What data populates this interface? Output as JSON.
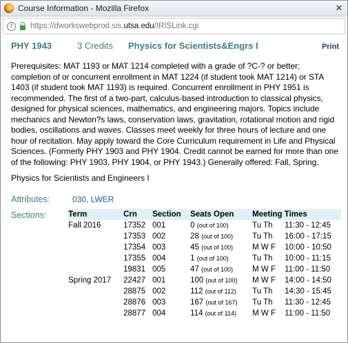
{
  "window": {
    "title": "Course Information - Mozilla Firefox",
    "close_glyph": "✕"
  },
  "urlbar": {
    "url_prefix": "https://dworkswebprod.sis.",
    "url_domain": "utsa.edu",
    "url_suffix": "/IRISLink.cgi"
  },
  "course": {
    "code": "PHY 1943",
    "credits": "3 Credits",
    "title": "Physics for Scientists&Engrs I",
    "print_label": "Print",
    "description": "Prerequisites: MAT 1193 or MAT 1214 completed with a grade of ?C-? or better; completion of or concurrent enrollment in MAT 1224 (if student took MAT 1214) or STA 1403 (if student took MAT 1193) is required. Concurrent enrollment in PHY 1951 is recommended. The first of a two-part, calculus-based introduction to classical physics, designed for physical sciences, mathematics, and engineering majors. Topics include mechanics and Newton?s laws, conservation laws, gravitation, rotational motion and rigid bodies, oscillations and waves. Classes meet weekly for three hours of lecture and one hour of recitation. May apply toward the Core Curriculum requirement in Life and Physical Sciences. (Formerly PHY 1903 and PHY 1904. Credit cannot be earned for more than one of the following: PHY 1903, PHY 1904, or PHY 1943.) Generally offered: Fall, Spring.",
    "long_title": "Physics for Scientists and Engineers I"
  },
  "attributes": {
    "label": "Attributes:",
    "value": "030, LWER"
  },
  "sections": {
    "label": "Sections:",
    "headers": [
      "Term",
      "Crn",
      "Section",
      "Seats Open",
      "Meeting Times"
    ],
    "rows": [
      {
        "term": "Fall 2016",
        "crn": "17352",
        "section": "001",
        "seats": "0",
        "seats_of": "(out of 100)",
        "days": "Tu Th",
        "time": "11:30 - 12:45"
      },
      {
        "term": "",
        "crn": "17353",
        "section": "002",
        "seats": "28",
        "seats_of": "(out of 100)",
        "days": "Tu Th",
        "time": "16:00 - 17:15"
      },
      {
        "term": "",
        "crn": "17354",
        "section": "003",
        "seats": "45",
        "seats_of": "(out of 100)",
        "days": "M W F",
        "time": "10:00 - 10:50"
      },
      {
        "term": "",
        "crn": "17355",
        "section": "004",
        "seats": "1",
        "seats_of": "(out of 100)",
        "days": "Tu Th",
        "time": "10:00 - 11:15"
      },
      {
        "term": "",
        "crn": "19831",
        "section": "005",
        "seats": "47",
        "seats_of": "(out of 100)",
        "days": "M W F",
        "time": "11:00 - 11:50"
      },
      {
        "term": "Spring 2017",
        "crn": "22427",
        "section": "001",
        "seats": "100",
        "seats_of": "(out of 100)",
        "days": "M W F",
        "time": "14:00 - 14:50"
      },
      {
        "term": "",
        "crn": "28875",
        "section": "002",
        "seats": "112",
        "seats_of": "(out of 112)",
        "days": "Tu Th",
        "time": "14:30 - 15:45"
      },
      {
        "term": "",
        "crn": "28876",
        "section": "003",
        "seats": "167",
        "seats_of": "(out of 167)",
        "days": "Tu Th",
        "time": "11:30 - 12:45"
      },
      {
        "term": "",
        "crn": "28877",
        "section": "004",
        "seats": "114",
        "seats_of": "(out of 114)",
        "days": "M W F",
        "time": "11:00 - 11:50"
      }
    ]
  },
  "colors": {
    "accent_teal": "#3a7d85",
    "link_blue": "#1b5aa0",
    "table_header_bg": "#dff1f5"
  }
}
